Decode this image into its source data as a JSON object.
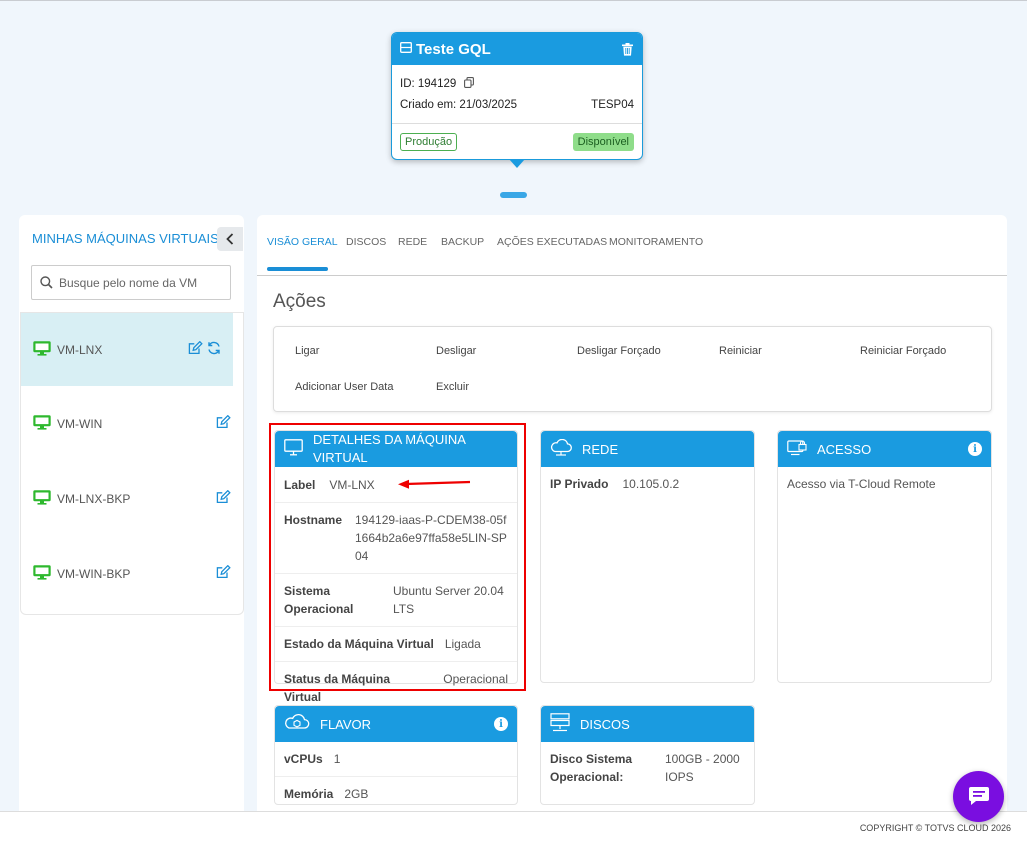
{
  "vm_card": {
    "title": "Teste GQL",
    "id_label": "ID: 194129",
    "created_label": "Criado em: 21/03/2025",
    "site": "TESP04",
    "environment_badge": "Produção",
    "status_badge": "Disponível",
    "accent_color": "#1a9be0"
  },
  "sidebar": {
    "title": "MINHAS MÁQUINAS VIRTUAIS",
    "search_placeholder": "Busque pelo nome da VM",
    "items": [
      {
        "name": "VM-LNX",
        "active": true
      },
      {
        "name": "VM-WIN"
      },
      {
        "name": "VM-LNX-BKP"
      },
      {
        "name": "VM-WIN-BKP"
      }
    ]
  },
  "tabs": [
    "VISÃO GERAL",
    "DISCOS",
    "REDE",
    "BACKUP",
    "AÇÕES EXECUTADAS",
    "MONITORAMENTO"
  ],
  "acoes": {
    "title": "Ações",
    "items": [
      "Ligar",
      "Desligar",
      "Desligar Forçado",
      "Reiniciar",
      "Reiniciar Forçado",
      "Adicionar User Data",
      "Excluir"
    ]
  },
  "details": {
    "title": "DETALHES DA MÁQUINA VIRTUAL",
    "label_k": "Label",
    "label_v": "VM-LNX",
    "hostname_k": "Hostname",
    "hostname_v": "194129-iaas-P-CDEM38-05f1664b2a6e97ffa58e5LIN-SP04",
    "so_k": "Sistema Operacional",
    "so_v": "Ubuntu Server 20.04 LTS",
    "estado_k": "Estado da Máquina Virtual",
    "estado_v": "Ligada",
    "status_k": "Status da Máquina Virtual",
    "status_v": "Operacional"
  },
  "rede": {
    "title": "REDE",
    "ip_k": "IP Privado",
    "ip_v": "10.105.0.2"
  },
  "acesso": {
    "title": "ACESSO",
    "text": "Acesso via T-Cloud Remote"
  },
  "flavor": {
    "title": "FLAVOR",
    "vcpu_k": "vCPUs",
    "vcpu_v": "1",
    "mem_k": "Memória",
    "mem_v": "2GB"
  },
  "discos": {
    "title": "DISCOS",
    "disk_k": "Disco Sistema Operacional:",
    "disk_v": "100GB - 2000 IOPS"
  },
  "footer": {
    "copyright": "COPYRIGHT © TOTVS CLOUD 2026"
  },
  "icons": {
    "vm": "monitor-icon",
    "edit": "edit-icon",
    "refresh": "refresh-icon",
    "search": "search-icon",
    "chat": "chat-icon",
    "info": "info-icon"
  }
}
